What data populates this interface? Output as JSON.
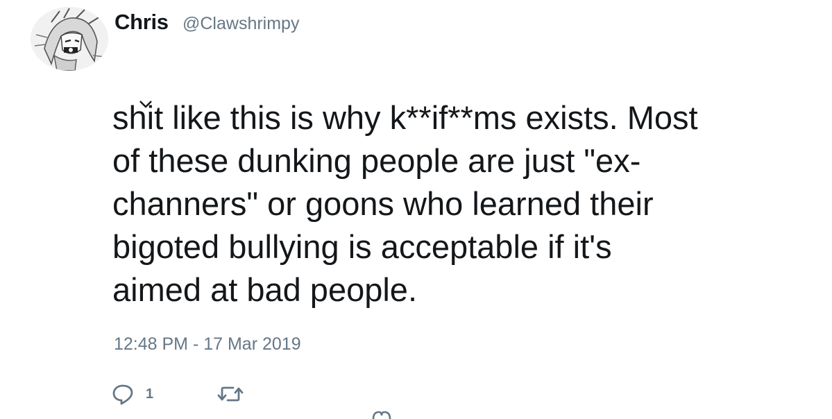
{
  "tweet": {
    "author": {
      "display_name": "Chris",
      "handle": "@Clawshrimpy",
      "avatar_icon": "anime-character-avatar"
    },
    "body_lines": [
      "shit like this is why k**if**ms exists. Most",
      "of these dunking people are just \"ex-",
      "channers\" or goons who learned their",
      "bigoted bullying is acceptable if it's",
      "aimed at bad people."
    ],
    "timestamp": "12:48 PM - 17 Mar 2019",
    "actions": {
      "reply": {
        "icon": "reply-icon",
        "count": "1"
      },
      "retweet": {
        "icon": "retweet-icon",
        "count": ""
      }
    }
  },
  "colors": {
    "text": "#14171a",
    "secondary": "#657786",
    "background": "#ffffff"
  }
}
